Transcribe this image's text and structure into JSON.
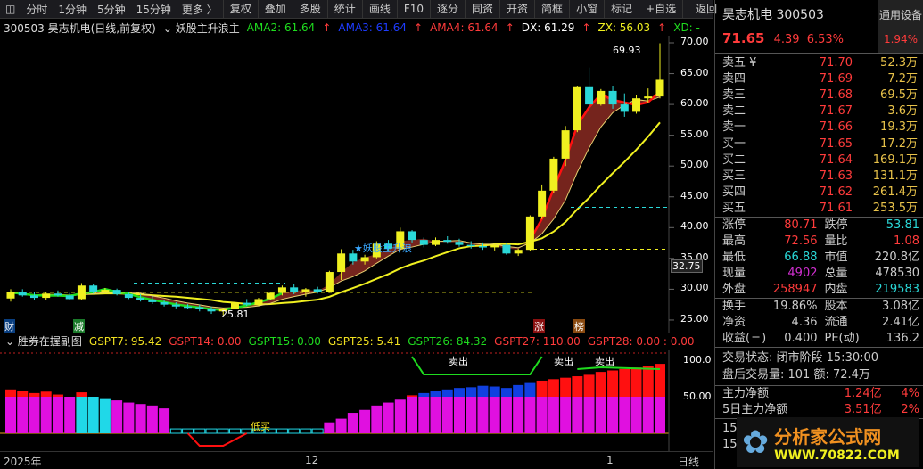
{
  "toolbar": {
    "left": [
      "分时",
      "1分钟",
      "5分钟",
      "15分钟",
      "更多 〉"
    ],
    "right": [
      "复权",
      "叠加",
      "多股",
      "统计",
      "画线",
      "F10",
      "逐分",
      "同资",
      "开资",
      "简框",
      "小窗",
      "标记",
      "+自选",
      "返回"
    ]
  },
  "header": {
    "title": "300503 昊志机电(日线,前复权)",
    "indicator": "妖股主升浪主",
    "ama2": "AMA2: 61.64",
    "ama3": "AMA3: 61.64",
    "ama4": "AMA4: 61.64",
    "dx": "DX: 61.29",
    "zx": "ZX: 56.03",
    "xd": "XD: -"
  },
  "price_axis": [
    "70.00",
    "65.00",
    "60.00",
    "55.00",
    "50.00",
    "45.00",
    "40.00",
    "35.00",
    "30.00",
    "25.00"
  ],
  "current_price_tag": "32.75",
  "annotations": {
    "high": "69.93",
    "low": "25.81",
    "signal": "★妖股主升浪",
    "marks": [
      "财",
      "减",
      "涨",
      "榜"
    ]
  },
  "sub": {
    "title": "胜券在握副图",
    "g7": "GSPT7: 95.42",
    "g14": "GSPT14: 0.00",
    "g15": "GSPT15: 0.00",
    "g25": "GSPT25: 5.41",
    "g26": "GSPT26: 84.32",
    "g27": "GSPT27: 110.00",
    "g28": "GSPT28: 0.00 : 0.00",
    "axis": [
      "100.0",
      "50.00"
    ],
    "labels": [
      "卖出",
      "卖出",
      "卖出",
      "低买"
    ]
  },
  "time_axis": {
    "labels": [
      "2025年",
      "12",
      "1"
    ],
    "period": "日线"
  },
  "quote": {
    "name": "昊志机电 300503",
    "sector": "通用设备",
    "sector_change": "1.94%",
    "price": "71.65",
    "change": "4.39",
    "pct": "6.53%",
    "asks": [
      [
        "卖五 ¥",
        "71.70",
        "52.3万"
      ],
      [
        "卖四",
        "71.69",
        "7.2万"
      ],
      [
        "卖三",
        "71.68",
        "69.5万"
      ],
      [
        "卖二",
        "71.67",
        "3.6万"
      ],
      [
        "卖一",
        "71.66",
        "19.3万"
      ]
    ],
    "bids": [
      [
        "买一",
        "71.65",
        "17.2万"
      ],
      [
        "买二",
        "71.64",
        "169.1万"
      ],
      [
        "买三",
        "71.63",
        "131.1万"
      ],
      [
        "买四",
        "71.62",
        "261.4万"
      ],
      [
        "买五",
        "71.61",
        "253.5万"
      ]
    ],
    "stats1": [
      [
        "涨停",
        "80.71",
        "跌停",
        "53.81"
      ],
      [
        "最高",
        "72.56",
        "量比",
        "1.08"
      ],
      [
        "最低",
        "66.88",
        "市值",
        "220.8亿"
      ],
      [
        "现量",
        "4902",
        "总量",
        "478530"
      ],
      [
        "外盘",
        "258947",
        "内盘",
        "219583"
      ]
    ],
    "stats2": [
      [
        "换手",
        "19.86%",
        "股本",
        "3.08亿"
      ],
      [
        "净资",
        "4.36",
        "流通",
        "2.41亿"
      ],
      [
        "收益(三)",
        "0.400",
        "PE(动)",
        "136.2"
      ]
    ],
    "status": "交易状态: 闭市阶段 15:30:00",
    "after": "盘后交易量: 101  额: 72.4万",
    "flow": [
      [
        "主力净额",
        "1.24亿",
        "4%"
      ],
      [
        "5日主力净额",
        "3.51亿",
        "2%"
      ]
    ],
    "times": [
      "15",
      "15"
    ]
  },
  "watermark": {
    "name": "分析家公式网",
    "url": "WWW.70822.COM"
  },
  "chart_data": {
    "type": "candlestick",
    "ylim": [
      23,
      72
    ],
    "candles": [
      [
        28.5,
        30,
        28,
        29.5
      ],
      [
        29.5,
        30,
        28.8,
        29
      ],
      [
        29,
        29.5,
        28.2,
        28.6
      ],
      [
        28.6,
        29.5,
        28.3,
        29.3
      ],
      [
        29.3,
        29.8,
        28.8,
        29
      ],
      [
        29,
        29.4,
        28.2,
        28.4
      ],
      [
        28.4,
        31,
        28.3,
        30.6
      ],
      [
        30.6,
        30.8,
        29.3,
        29.6
      ],
      [
        29.6,
        30.2,
        29.2,
        29.9
      ],
      [
        29.9,
        30.1,
        29,
        29.2
      ],
      [
        29.2,
        29.6,
        28.4,
        28.6
      ],
      [
        28.6,
        29.2,
        28,
        28.3
      ],
      [
        28.3,
        28.9,
        27.6,
        27.9
      ],
      [
        27.9,
        28.3,
        27.2,
        27.5
      ],
      [
        27.5,
        27.9,
        26.9,
        27.2
      ],
      [
        27.2,
        27.6,
        26.8,
        27.1
      ],
      [
        27.1,
        27.5,
        26.4,
        26.8
      ],
      [
        26.8,
        27.2,
        26,
        26.4
      ],
      [
        26.4,
        27,
        25.8,
        26.8
      ],
      [
        26.8,
        28,
        26.5,
        27.8
      ],
      [
        27.8,
        28.4,
        27.3,
        27.5
      ],
      [
        27.5,
        28.6,
        27.3,
        28.4
      ],
      [
        28.4,
        29.6,
        28.2,
        29.4
      ],
      [
        29.4,
        30.6,
        29,
        30.3
      ],
      [
        30.3,
        30.8,
        29.2,
        29.5
      ],
      [
        29.5,
        30.2,
        28.8,
        30
      ],
      [
        30,
        30.4,
        29.3,
        29.6
      ],
      [
        29.6,
        33,
        29.4,
        32.8
      ],
      [
        32.8,
        36.5,
        31.5,
        35.8
      ],
      [
        35.8,
        36.4,
        34,
        34.5
      ],
      [
        34.5,
        35.6,
        34,
        35.2
      ],
      [
        35.2,
        37.8,
        35,
        37.4
      ],
      [
        37.4,
        38,
        36.2,
        36.6
      ],
      [
        36.6,
        40,
        36.3,
        39.4
      ],
      [
        39.4,
        39.6,
        37.6,
        38
      ],
      [
        38,
        38.4,
        36.8,
        37.2
      ],
      [
        37.2,
        38.4,
        37,
        38
      ],
      [
        38,
        38.6,
        37.4,
        37.7
      ],
      [
        37.7,
        38.2,
        36.9,
        37.2
      ],
      [
        37.2,
        37.8,
        36.6,
        37
      ],
      [
        37,
        37.6,
        36.4,
        36.8
      ],
      [
        36.8,
        37.4,
        36.3,
        37.2
      ],
      [
        37.2,
        37.5,
        35.6,
        35.8
      ],
      [
        35.8,
        36.6,
        35.4,
        36.4
      ],
      [
        36.4,
        42,
        36.2,
        41.8
      ],
      [
        41.8,
        47,
        41.4,
        46
      ],
      [
        46,
        51.5,
        45.6,
        51.2
      ],
      [
        51.2,
        56.5,
        50,
        55.8
      ],
      [
        55.8,
        63,
        55.5,
        62.8
      ],
      [
        62.8,
        66,
        59.5,
        60
      ],
      [
        60,
        62.5,
        59.8,
        62.2
      ],
      [
        62.2,
        63,
        59.3,
        60
      ],
      [
        60,
        61.8,
        58,
        58.8
      ],
      [
        58.8,
        61.6,
        58.5,
        61
      ],
      [
        61,
        62.6,
        60.2,
        61.3
      ],
      [
        61.3,
        69.93,
        61,
        64
      ]
    ],
    "volume": [
      60,
      58,
      55,
      57,
      53,
      50,
      56,
      50,
      48,
      45,
      42,
      40,
      38,
      34,
      6,
      6,
      6,
      6,
      6,
      6,
      6,
      6,
      6,
      6,
      6,
      6,
      6,
      15,
      20,
      28,
      32,
      38,
      42,
      46,
      52,
      55,
      58,
      60,
      62,
      63,
      65,
      64,
      62,
      66,
      70,
      72,
      74,
      76,
      78,
      80,
      84,
      86,
      88,
      90,
      92,
      95
    ]
  }
}
